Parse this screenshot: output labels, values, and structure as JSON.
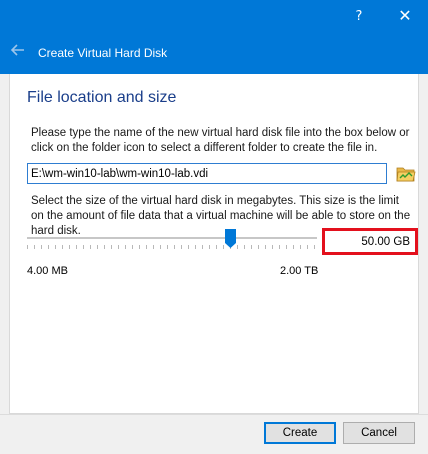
{
  "titlebar": {
    "help_label": "?",
    "close_label": "✕"
  },
  "header": {
    "title": "Create Virtual Hard Disk",
    "back_icon": "arrow-left-icon"
  },
  "section": {
    "title": "File location and size"
  },
  "location": {
    "hint": "Please type the name of the new virtual hard disk file into the box below or click on the folder icon to select a different folder to create the file in.",
    "value": "E:\\wm-win10-lab\\wm-win10-lab.vdi",
    "folder_icon": "folder-icon"
  },
  "size": {
    "hint": "Select the size of the virtual hard disk in megabytes. This size is the limit on the amount of file data that a virtual machine will be able to store on the hard disk.",
    "value": "50.00 GB",
    "slider_fraction": 0.7,
    "min_label": "4.00 MB",
    "max_label": "2.00 TB",
    "highlight_color": "#e3101d"
  },
  "buttons": {
    "create": "Create",
    "cancel": "Cancel"
  },
  "colors": {
    "accent": "#0078d7",
    "title_text": "#1a3e8a"
  }
}
